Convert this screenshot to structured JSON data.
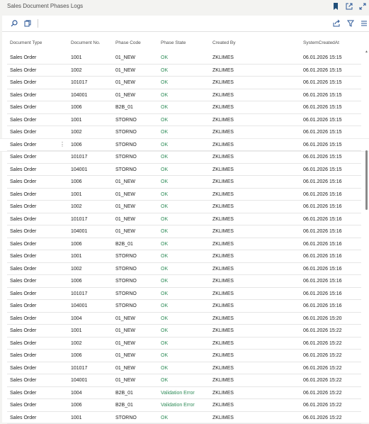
{
  "app": {
    "title": "Sales Document Phases Logs"
  },
  "grid": {
    "columns": {
      "document_type": "Document Type",
      "document_no": "Document No.",
      "phase_code": "Phase Code",
      "phase_state": "Phase State",
      "created_by": "Created By",
      "system_created_at": "SystemCreatedAt"
    },
    "selected_row_index": 7,
    "rows": [
      {
        "document_type": "Sales Order",
        "document_no": "1001",
        "phase_code": "01_NEW",
        "phase_state": "OK",
        "created_by": "ZKLIMES",
        "system_created_at": "06.01.2026 15:15"
      },
      {
        "document_type": "Sales Order",
        "document_no": "1002",
        "phase_code": "01_NEW",
        "phase_state": "OK",
        "created_by": "ZKLIMES",
        "system_created_at": "06.01.2026 15:15"
      },
      {
        "document_type": "Sales Order",
        "document_no": "101017",
        "phase_code": "01_NEW",
        "phase_state": "OK",
        "created_by": "ZKLIMES",
        "system_created_at": "06.01.2026 15:15"
      },
      {
        "document_type": "Sales Order",
        "document_no": "104001",
        "phase_code": "01_NEW",
        "phase_state": "OK",
        "created_by": "ZKLIMES",
        "system_created_at": "06.01.2026 15:15"
      },
      {
        "document_type": "Sales Order",
        "document_no": "1006",
        "phase_code": "B2B_01",
        "phase_state": "OK",
        "created_by": "ZKLIMES",
        "system_created_at": "06.01.2026 15:15"
      },
      {
        "document_type": "Sales Order",
        "document_no": "1001",
        "phase_code": "STORNO",
        "phase_state": "OK",
        "created_by": "ZKLIMES",
        "system_created_at": "06.01.2026 15:15"
      },
      {
        "document_type": "Sales Order",
        "document_no": "1002",
        "phase_code": "STORNO",
        "phase_state": "OK",
        "created_by": "ZKLIMES",
        "system_created_at": "06.01.2026 15:15"
      },
      {
        "document_type": "Sales Order",
        "document_no": "1006",
        "phase_code": "STORNO",
        "phase_state": "OK",
        "created_by": "ZKLIMES",
        "system_created_at": "06.01.2026 15:15"
      },
      {
        "document_type": "Sales Order",
        "document_no": "101017",
        "phase_code": "STORNO",
        "phase_state": "OK",
        "created_by": "ZKLIMES",
        "system_created_at": "06.01.2026 15:15"
      },
      {
        "document_type": "Sales Order",
        "document_no": "104001",
        "phase_code": "STORNO",
        "phase_state": "OK",
        "created_by": "ZKLIMES",
        "system_created_at": "06.01.2026 15:15"
      },
      {
        "document_type": "Sales Order",
        "document_no": "1006",
        "phase_code": "01_NEW",
        "phase_state": "OK",
        "created_by": "ZKLIMES",
        "system_created_at": "06.01.2026 15:16"
      },
      {
        "document_type": "Sales Order",
        "document_no": "1001",
        "phase_code": "01_NEW",
        "phase_state": "OK",
        "created_by": "ZKLIMES",
        "system_created_at": "06.01.2026 15:16"
      },
      {
        "document_type": "Sales Order",
        "document_no": "1002",
        "phase_code": "01_NEW",
        "phase_state": "OK",
        "created_by": "ZKLIMES",
        "system_created_at": "06.01.2026 15:16"
      },
      {
        "document_type": "Sales Order",
        "document_no": "101017",
        "phase_code": "01_NEW",
        "phase_state": "OK",
        "created_by": "ZKLIMES",
        "system_created_at": "06.01.2026 15:16"
      },
      {
        "document_type": "Sales Order",
        "document_no": "104001",
        "phase_code": "01_NEW",
        "phase_state": "OK",
        "created_by": "ZKLIMES",
        "system_created_at": "06.01.2026 15:16"
      },
      {
        "document_type": "Sales Order",
        "document_no": "1006",
        "phase_code": "B2B_01",
        "phase_state": "OK",
        "created_by": "ZKLIMES",
        "system_created_at": "06.01.2026 15:16"
      },
      {
        "document_type": "Sales Order",
        "document_no": "1001",
        "phase_code": "STORNO",
        "phase_state": "OK",
        "created_by": "ZKLIMES",
        "system_created_at": "06.01.2026 15:16"
      },
      {
        "document_type": "Sales Order",
        "document_no": "1002",
        "phase_code": "STORNO",
        "phase_state": "OK",
        "created_by": "ZKLIMES",
        "system_created_at": "06.01.2026 15:16"
      },
      {
        "document_type": "Sales Order",
        "document_no": "1006",
        "phase_code": "STORNO",
        "phase_state": "OK",
        "created_by": "ZKLIMES",
        "system_created_at": "06.01.2026 15:16"
      },
      {
        "document_type": "Sales Order",
        "document_no": "101017",
        "phase_code": "STORNO",
        "phase_state": "OK",
        "created_by": "ZKLIMES",
        "system_created_at": "06.01.2026 15:16"
      },
      {
        "document_type": "Sales Order",
        "document_no": "104001",
        "phase_code": "STORNO",
        "phase_state": "OK",
        "created_by": "ZKLIMES",
        "system_created_at": "06.01.2026 15:16"
      },
      {
        "document_type": "Sales Order",
        "document_no": "1004",
        "phase_code": "01_NEW",
        "phase_state": "OK",
        "created_by": "ZKLIMES",
        "system_created_at": "06.01.2026 15:20"
      },
      {
        "document_type": "Sales Order",
        "document_no": "1001",
        "phase_code": "01_NEW",
        "phase_state": "OK",
        "created_by": "ZKLIMES",
        "system_created_at": "06.01.2026 15:22"
      },
      {
        "document_type": "Sales Order",
        "document_no": "1002",
        "phase_code": "01_NEW",
        "phase_state": "OK",
        "created_by": "ZKLIMES",
        "system_created_at": "06.01.2026 15:22"
      },
      {
        "document_type": "Sales Order",
        "document_no": "1006",
        "phase_code": "01_NEW",
        "phase_state": "OK",
        "created_by": "ZKLIMES",
        "system_created_at": "06.01.2026 15:22"
      },
      {
        "document_type": "Sales Order",
        "document_no": "101017",
        "phase_code": "01_NEW",
        "phase_state": "OK",
        "created_by": "ZKLIMES",
        "system_created_at": "06.01.2026 15:22"
      },
      {
        "document_type": "Sales Order",
        "document_no": "104001",
        "phase_code": "01_NEW",
        "phase_state": "OK",
        "created_by": "ZKLIMES",
        "system_created_at": "06.01.2026 15:22"
      },
      {
        "document_type": "Sales Order",
        "document_no": "1004",
        "phase_code": "B2B_01",
        "phase_state": "Validation Error",
        "created_by": "ZKLIMES",
        "system_created_at": "06.01.2026 15:22"
      },
      {
        "document_type": "Sales Order",
        "document_no": "1006",
        "phase_code": "B2B_01",
        "phase_state": "Validation Error",
        "created_by": "ZKLIMES",
        "system_created_at": "06.01.2026 15:22"
      },
      {
        "document_type": "Sales Order",
        "document_no": "1001",
        "phase_code": "STORNO",
        "phase_state": "OK",
        "created_by": "ZKLIMES",
        "system_created_at": "06.01.2026 15:22"
      }
    ]
  },
  "colors": {
    "state_ok": "#2e8b57",
    "accent": "#2b5797"
  },
  "icons": [
    "bookmark-icon",
    "open-new-window-icon",
    "expand-icon",
    "search-icon",
    "edit-list-icon",
    "share-icon",
    "filter-icon",
    "list-view-icon",
    "row-menu-icon"
  ]
}
